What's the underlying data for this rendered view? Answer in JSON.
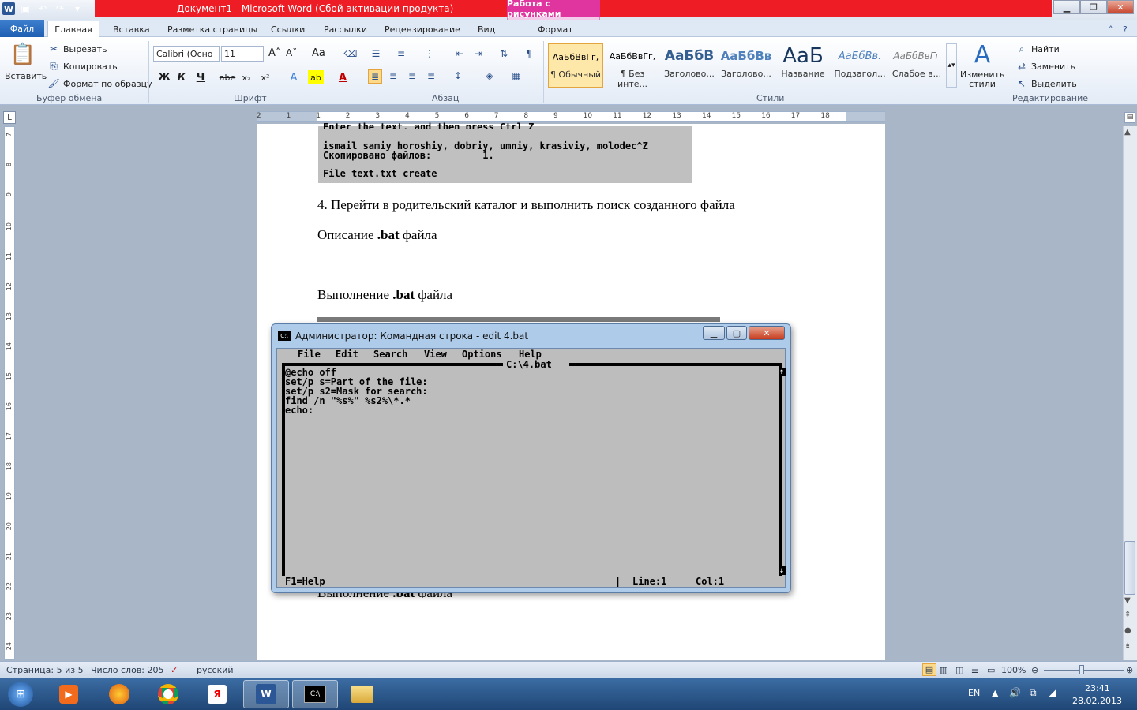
{
  "window": {
    "title": "Документ1 - Microsoft Word (Сбой активации продукта)",
    "context_tab_group": "Работа с рисунками",
    "context_tab": "Формат"
  },
  "tabs": {
    "file": "Файл",
    "items": [
      "Главная",
      "Вставка",
      "Разметка страницы",
      "Ссылки",
      "Рассылки",
      "Рецензирование",
      "Вид"
    ]
  },
  "ribbon": {
    "clipboard": {
      "paste": "Вставить",
      "cut": "Вырезать",
      "copy": "Копировать",
      "format_painter": "Формат по образцу",
      "label": "Буфер обмена"
    },
    "font": {
      "name": "Calibri (Осно",
      "size": "11",
      "label": "Шрифт",
      "bold": "Ж",
      "italic": "К",
      "underline": "Ч",
      "strike": "abe",
      "sub": "x₂",
      "sup": "x²",
      "grow": "A˄",
      "shrink": "A˅",
      "case": "Aa"
    },
    "paragraph": {
      "label": "Абзац"
    },
    "styles": {
      "label": "Стили",
      "items": [
        {
          "preview": "АаБбВвГг,",
          "name": "¶ Обычный"
        },
        {
          "preview": "АаБбВвГг,",
          "name": "¶ Без инте..."
        },
        {
          "preview": "АаБбВ",
          "name": "Заголово..."
        },
        {
          "preview": "АаБбВв",
          "name": "Заголово..."
        },
        {
          "preview": "АаБ",
          "name": "Название"
        },
        {
          "preview": "АаБбВв.",
          "name": "Подзагол..."
        },
        {
          "preview": "АаБбВвГг",
          "name": "Слабое в..."
        }
      ],
      "change": "Изменить стили"
    },
    "editing": {
      "label": "Редактирование",
      "find": "Найти",
      "replace": "Заменить",
      "select": "Выделить"
    }
  },
  "ruler": {
    "h_ticks": [
      "2",
      "1",
      "1",
      "2",
      "3",
      "4",
      "5",
      "6",
      "7",
      "8",
      "9",
      "10",
      "11",
      "12",
      "13",
      "14",
      "15",
      "16",
      "17",
      "18"
    ],
    "v_ticks": [
      "7",
      "8",
      "9",
      "10",
      "11",
      "12",
      "13",
      "14",
      "15",
      "16",
      "17",
      "18",
      "19",
      "20",
      "21",
      "22",
      "23",
      "24"
    ]
  },
  "document": {
    "screenshot_lines": [
      "Enter the text, and then press Ctrl Z",
      "ismail samiy horoshiy, dobriy, umniy, krasiviy, molodec^Z",
      "Скопировано файлов:         1.",
      "File text.txt create"
    ],
    "step": "4. Перейти в родительский каталог и выполнить поиск созданного файла",
    "desc_prefix": "Описание ",
    "bat": ".bat",
    "desc_suffix": " файла",
    "exec_prefix": "Выполнение ",
    "exec_suffix": " файла"
  },
  "cmd": {
    "title": "Администратор: Командная строка - edit  4.bat",
    "menu": [
      "File",
      "Edit",
      "Search",
      "View",
      "Options",
      "Help"
    ],
    "file_name": "C:\\4.bat",
    "lines": [
      "@echo off",
      "set/p s=Part of the file:",
      "set/p s2=Mask for search:",
      "find /n \"%s%\" %s2%\\*.*",
      "echo:"
    ],
    "status_help": "F1=Help",
    "status_line": "Line:1",
    "status_col": "Col:1"
  },
  "status": {
    "page": "Страница: 5 из 5",
    "words": "Число слов: 205",
    "lang": "русский",
    "zoom": "100%"
  },
  "taskbar": {
    "lang": "EN",
    "time": "23:41",
    "date": "28.02.2013"
  },
  "colors": {
    "title_red": "#ee1c24",
    "context_pink": "#e0359e",
    "file_blue": "#1f5fb3",
    "taskbar": "#1f4675"
  }
}
